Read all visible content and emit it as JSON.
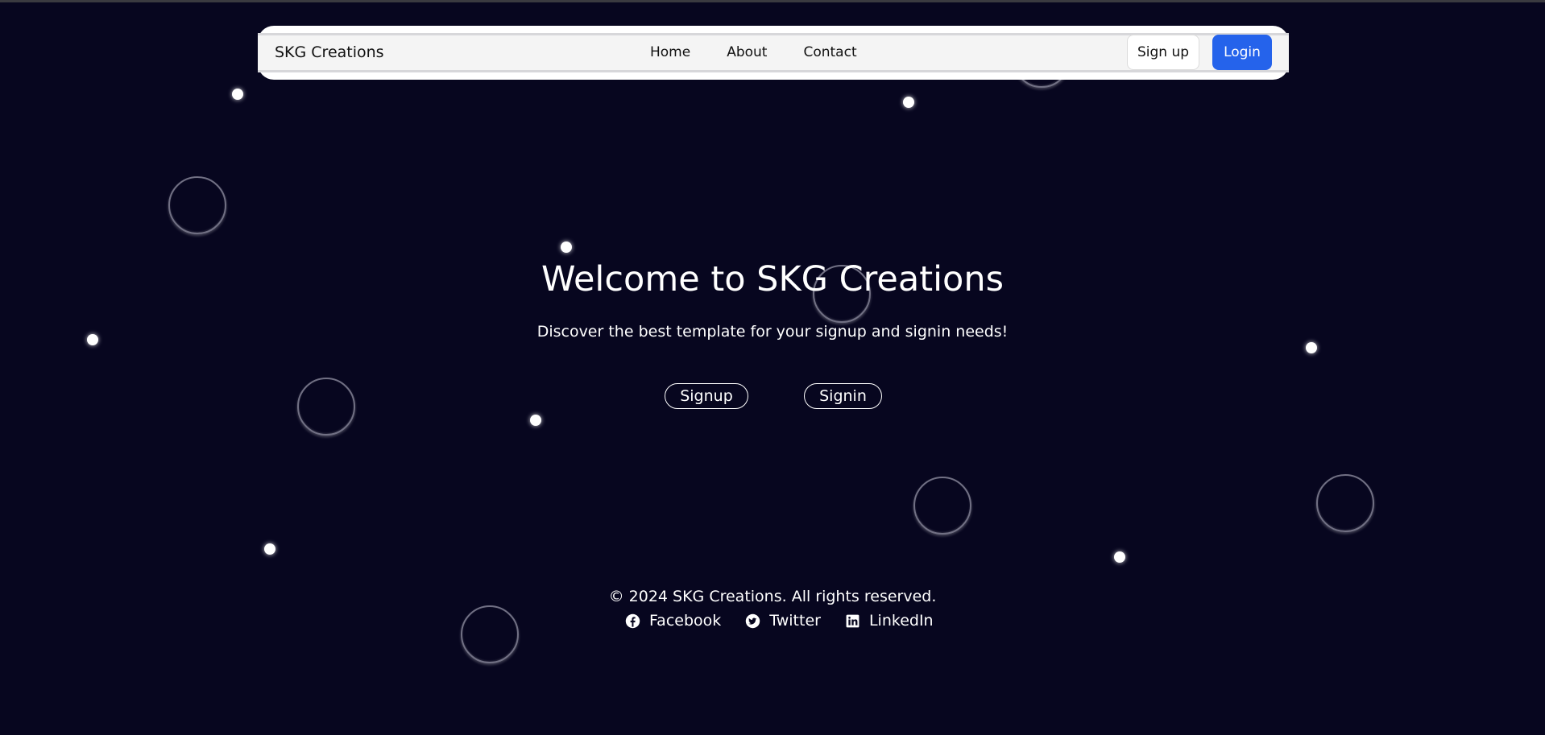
{
  "navbar": {
    "brand": "SKG Creations",
    "links": [
      "Home",
      "About",
      "Contact"
    ],
    "signup_label": "Sign up",
    "login_label": "Login"
  },
  "hero": {
    "title": "Welcome to SKG Creations",
    "subtitle": "Discover the best template for your signup and signin needs!",
    "signup_button": "Signup",
    "signin_button": "Signin"
  },
  "footer": {
    "copyright": "© 2024 SKG Creations. All rights reserved.",
    "social": [
      {
        "label": "Facebook",
        "icon": "facebook-icon"
      },
      {
        "label": "Twitter",
        "icon": "twitter-icon"
      },
      {
        "label": "LinkedIn",
        "icon": "linkedin-icon"
      }
    ]
  },
  "colors": {
    "background": "#07061f",
    "login_button": "#2563eb",
    "navbar": "#f4f4f4"
  }
}
